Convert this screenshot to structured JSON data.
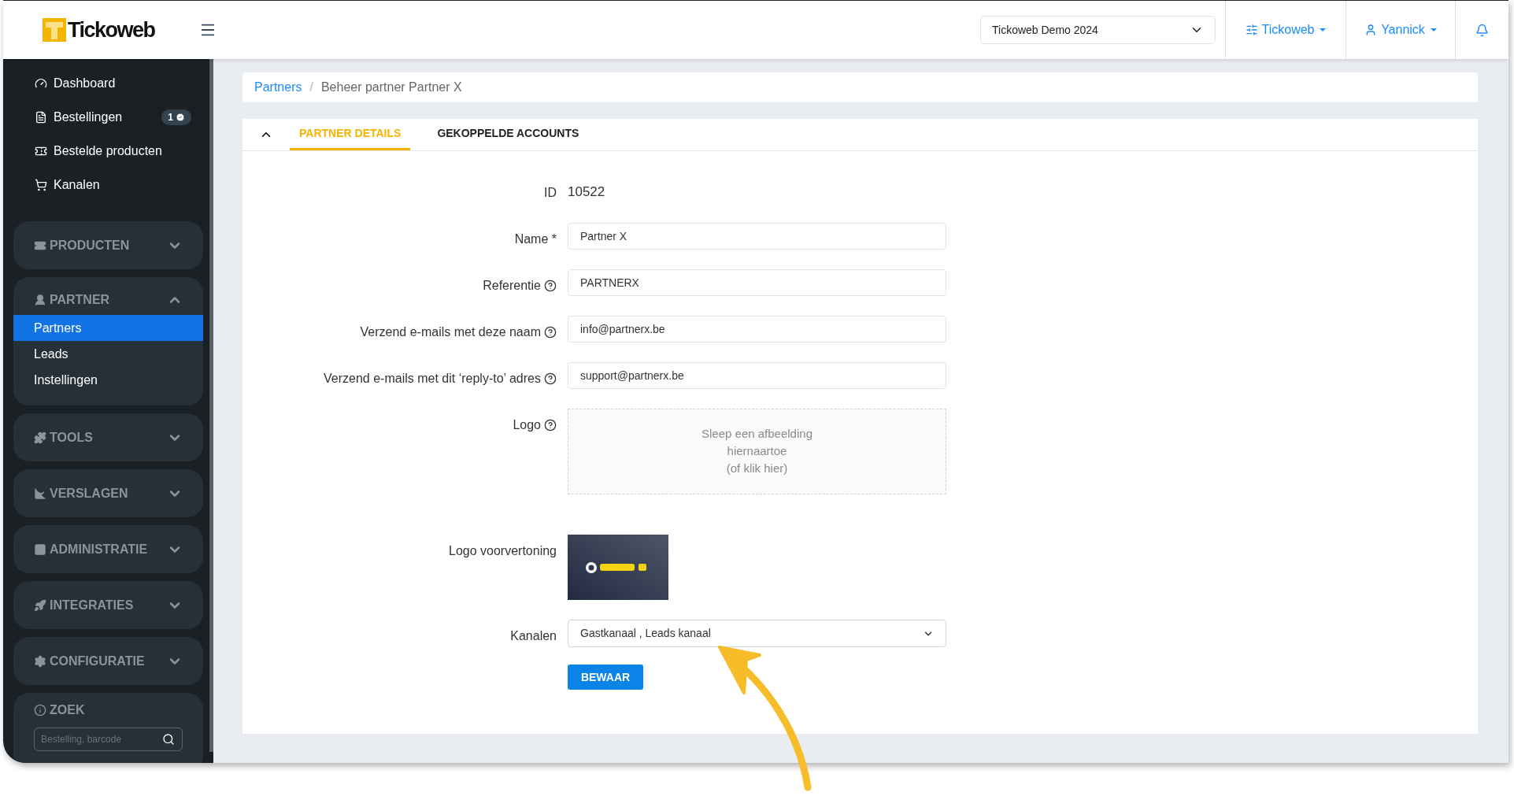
{
  "header": {
    "logo_text": "Tickoweb",
    "event_select": {
      "value": "Tickoweb Demo 2024"
    },
    "org_menu": "Tickoweb",
    "user_menu": "Yannick"
  },
  "sidebar": {
    "items": [
      {
        "label": "Dashboard"
      },
      {
        "label": "Bestellingen",
        "badge": "1"
      },
      {
        "label": "Bestelde producten"
      },
      {
        "label": "Kanalen"
      }
    ],
    "groups": [
      {
        "label": "PRODUCTEN",
        "expanded": false
      },
      {
        "label": "PARTNER",
        "expanded": true,
        "children": [
          {
            "label": "Partners",
            "selected": true
          },
          {
            "label": "Leads",
            "selected": false
          },
          {
            "label": "Instellingen",
            "selected": false
          }
        ]
      },
      {
        "label": "TOOLS",
        "expanded": false
      },
      {
        "label": "VERSLAGEN",
        "expanded": false
      },
      {
        "label": "ADMINISTRATIE",
        "expanded": false
      },
      {
        "label": "INTEGRATIES",
        "expanded": false
      },
      {
        "label": "CONFIGURATIE",
        "expanded": false
      }
    ],
    "search": {
      "title": "ZOEK",
      "placeholder": "Bestelling, barcode"
    }
  },
  "breadcrumb_separator": "/",
  "breadcrumb": [
    {
      "label": "Partners",
      "kind": "link"
    },
    {
      "label": "Beheer partner Partner X",
      "kind": "current"
    }
  ],
  "tabs": [
    {
      "label": "PARTNER DETAILS",
      "selected": true
    },
    {
      "label": "GEKOPPELDE ACCOUNTS",
      "selected": false
    }
  ],
  "form": {
    "fields": [
      {
        "kind": "text",
        "label": "ID",
        "value": "10522"
      },
      {
        "kind": "input",
        "label": "Name *",
        "value": "Partner X"
      },
      {
        "kind": "input",
        "label": "Referentie",
        "help": true,
        "value": "PARTNERX"
      },
      {
        "kind": "input",
        "label": "Verzend e-mails met deze naam",
        "help": true,
        "value": "info@partnerx.be"
      },
      {
        "kind": "input",
        "label": "Verzend e-mails met dit ‘reply-to’ adres",
        "help": true,
        "value": "support@partnerx.be"
      },
      {
        "kind": "dropzone",
        "label": "Logo",
        "help": true,
        "lines": [
          "Sleep een afbeelding",
          "hiernaartoe",
          "(of klik hier)"
        ]
      },
      {
        "kind": "picture",
        "label": "Logo voorvertoning"
      },
      {
        "kind": "select",
        "label": "Kanalen",
        "value": "Gastkanaal , Leads kanaal"
      }
    ],
    "submit": "BEWAAR"
  }
}
